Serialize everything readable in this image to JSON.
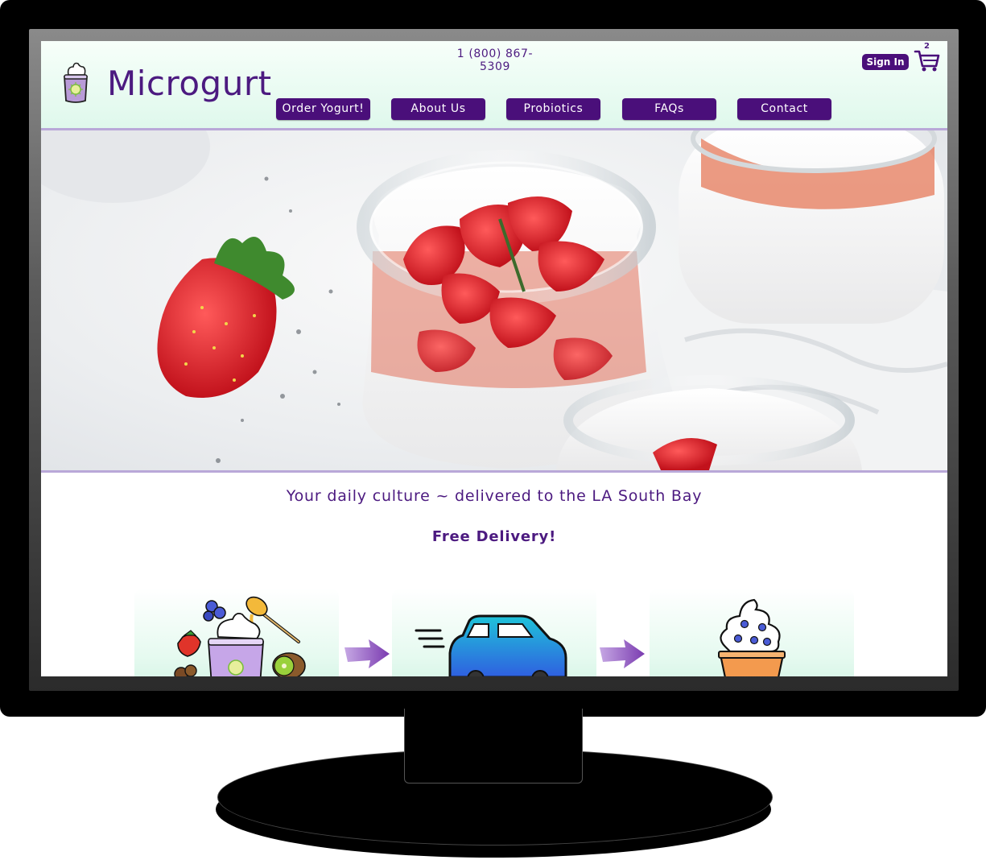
{
  "site": {
    "brand": "Microgurt",
    "phone": "1 (800) 867-5309",
    "sign_in": "Sign In",
    "cart_count": "2"
  },
  "nav": {
    "items": [
      {
        "label": "Order Yogurt!"
      },
      {
        "label": "About Us"
      },
      {
        "label": "Probiotics"
      },
      {
        "label": "FAQs"
      },
      {
        "label": "Contact"
      }
    ]
  },
  "main": {
    "tagline": "Your daily culture ~ delivered to the LA South Bay",
    "delivery": "Free Delivery!"
  },
  "steps": [
    {
      "icon": "yogurt-toppings-icon"
    },
    {
      "icon": "delivery-car-icon"
    },
    {
      "icon": "frozen-yogurt-cup-icon"
    }
  ],
  "colors": {
    "brand_purple": "#4a0f7a",
    "header_mint": "#dff8ec",
    "accent_lavender": "#b9a8d8"
  }
}
